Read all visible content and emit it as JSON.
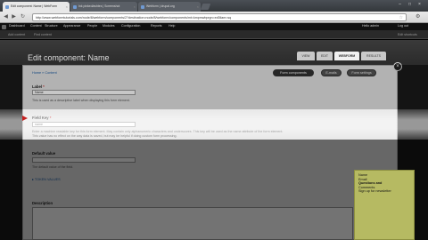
{
  "browser": {
    "tabs": [
      {
        "label": "Edit component: Name | WebForm"
      },
      {
        "label": "Ink pinked/ashtes | Screenshot"
      },
      {
        "label": "Webform | drupal.org"
      }
    ],
    "url": "http://www.webformtutorials.com/node/8/webform/components/2?destination=node/8/webform/components/mt=kmpmwbprgn=ed0ilam=sq",
    "window_controls": [
      "–",
      "□",
      "×"
    ]
  },
  "admin_bar": {
    "items": [
      "Dashboard",
      "Content",
      "Structure",
      "Appearance",
      "People",
      "Modules",
      "Configuration",
      "Reports",
      "Help"
    ],
    "user": "Hello admin",
    "logout": "Log out",
    "shortcuts": [
      "Add content",
      "Find content"
    ],
    "edit_shortcuts": "Edit shortcuts"
  },
  "page": {
    "title": "Edit component: Name",
    "tabs": [
      "VIEW",
      "EDIT",
      "WEBFORM",
      "RESULTS"
    ],
    "active_tab": "WEBFORM"
  },
  "dialog": {
    "breadcrumb": "Home » Content",
    "buttons": [
      "Form components",
      "E-mails",
      "Form settings"
    ],
    "active_button": "Form components",
    "fields": {
      "label": {
        "label": "Label",
        "value": "Name",
        "description": "This is used as a descriptive label when displaying this form element."
      },
      "field_key": {
        "label": "Field Key",
        "value": "name",
        "description": "Enter a machine readable key for this form element. May contain only alphanumeric characters and underscores. This key will be used as the name attribute of the form element.",
        "description2": "This value has no effect on the way data is saved, but may be helpful if doing custom form processing."
      },
      "default_value": {
        "label": "Default value",
        "value": "",
        "description": "The default value of the field."
      },
      "token_values": "TOKEN VALUES",
      "description": {
        "label": "Description"
      }
    }
  },
  "note": {
    "lines": [
      "Name",
      "Email",
      "Questions and",
      "Comments",
      "Sign up for newsletter"
    ]
  },
  "colors": {
    "note_bg": "#b6ba62",
    "link": "#2060a8",
    "arrow": "#c62020"
  }
}
